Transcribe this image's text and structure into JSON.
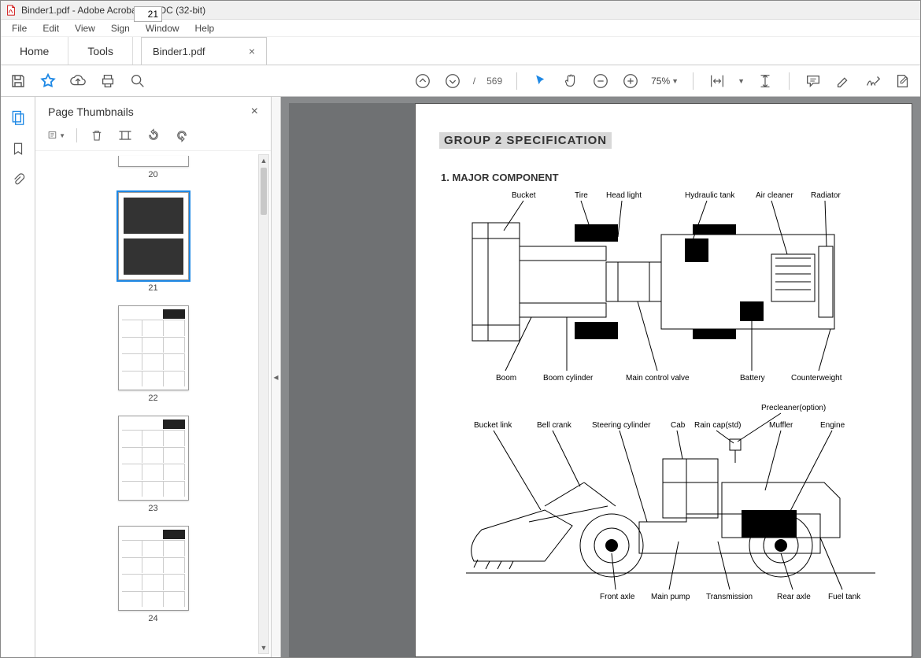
{
  "app": {
    "title": "Binder1.pdf - Adobe Acrobat Pro DC (32-bit)"
  },
  "menu": {
    "items": [
      "File",
      "Edit",
      "View",
      "Sign",
      "Window",
      "Help"
    ]
  },
  "tabs": {
    "home": "Home",
    "tools": "Tools",
    "doc": "Binder1.pdf"
  },
  "toolbar": {
    "page_current": "21",
    "page_sep": "/",
    "page_total": "569",
    "zoom": "75%"
  },
  "thumb": {
    "title": "Page Thumbnails",
    "pages": [
      "20",
      "21",
      "22",
      "23",
      "24"
    ]
  },
  "doc": {
    "group_title": "GROUP  2  SPECIFICATION",
    "section1": "1. MAJOR COMPONENT",
    "top_labels": {
      "bucket": "Bucket",
      "tire": "Tire",
      "headlight": "Head light",
      "hydraulic": "Hydraulic tank",
      "aircleaner": "Air cleaner",
      "radiator": "Radiator",
      "boom": "Boom",
      "boomcyl": "Boom cylinder",
      "mcv": "Main control valve",
      "battery": "Battery",
      "counterweight": "Counterweight"
    },
    "side_labels": {
      "precleaner": "Precleaner(option)",
      "bucketlink": "Bucket link",
      "bellcrank": "Bell crank",
      "steercyl": "Steering cylinder",
      "cab": "Cab",
      "raincap": "Rain cap(std)",
      "muffler": "Muffler",
      "engine": "Engine",
      "frontaxle": "Front axle",
      "mainpump": "Main pump",
      "transmission": "Transmission",
      "rearaxle": "Rear axle",
      "fueltank": "Fuel tank"
    }
  }
}
